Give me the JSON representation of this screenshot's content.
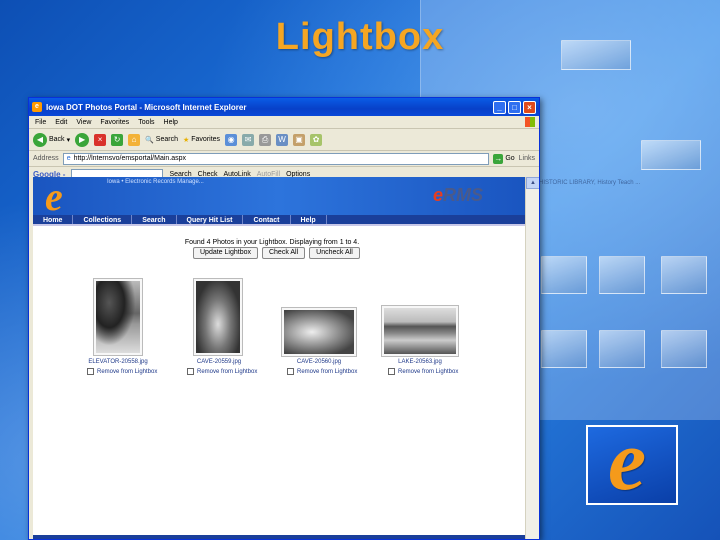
{
  "slide": {
    "title": "Lightbox"
  },
  "window": {
    "title": "Iowa DOT Photos Portal - Microsoft Internet Explorer",
    "menu": [
      "File",
      "Edit",
      "View",
      "Favorites",
      "Tools",
      "Help"
    ],
    "toolbar": {
      "back": "Back",
      "search": "Search",
      "favorites": "Favorites"
    },
    "address": {
      "label": "Address",
      "url": "http://lnternsvo/emsportal/Main.aspx",
      "go": "Go",
      "links": "Links"
    },
    "google": {
      "logo": "Google -",
      "search": "Search",
      "check": "Check",
      "autolink": "AutoLink",
      "autofill": "AutoFill",
      "options": "Options"
    }
  },
  "banner": {
    "sub": "Iowa • Electronic Records Manage...",
    "logo_e": "e",
    "logo_text": "RMS"
  },
  "nav": [
    "Home",
    "Collections",
    "Search",
    "Query Hit List",
    "Contact",
    "Help"
  ],
  "lightbox": {
    "found_text": "Found 4 Photos in your Lightbox. Displaying from 1 to 4.",
    "buttons": {
      "update": "Update Lightbox",
      "check_all": "Check All",
      "uncheck_all": "Uncheck All"
    },
    "remove_label": "Remove from Lightbox",
    "photos": [
      {
        "file": "ELEVATOR-20558.jpg"
      },
      {
        "file": "CAVE-20559.jpg"
      },
      {
        "file": "CAVE-20560.jpg"
      },
      {
        "file": "LAKE-20563.jpg"
      }
    ]
  },
  "colors": {
    "title": "#f5a623",
    "accent_blue": "#1a3f9a",
    "ie_titlebar": "#0a5ce6"
  }
}
